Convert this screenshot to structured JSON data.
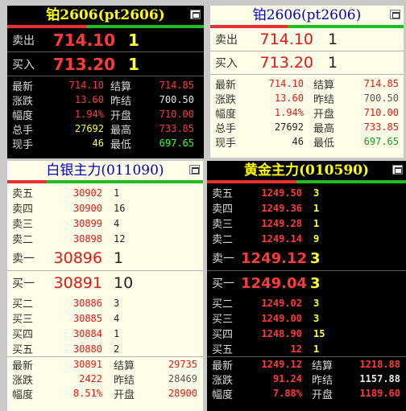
{
  "colors": {
    "up": "#ff3a3a",
    "down": "#33ff33",
    "volume": "#ffff33",
    "title_dark": "#ffff00",
    "title_light": "#0000c0"
  },
  "icons": {
    "panel_button": "maximize-icon"
  },
  "panels": {
    "pt_dark": {
      "title": "铂2606(pt2606)",
      "sell": {
        "label": "卖出",
        "price": "714.10",
        "vol": "1"
      },
      "buy": {
        "label": "买入",
        "price": "713.20",
        "vol": "1"
      },
      "stats": [
        {
          "l1": "最新",
          "v1": "714.10",
          "l2": "结算",
          "v2": "714.85"
        },
        {
          "l1": "涨跌",
          "v1": "13.60",
          "l2": "昨结",
          "v2": "700.50"
        },
        {
          "l1": "幅度",
          "v1": "1.94%",
          "l2": "开盘",
          "v2": "710.00"
        },
        {
          "l1": "总手",
          "v1": "27692",
          "l2": "最高",
          "v2": "733.85"
        },
        {
          "l1": "现手",
          "v1": "46",
          "l2": "最低",
          "v2": "697.65"
        }
      ]
    },
    "pt_light": {
      "title": "铂2606(pt2606)",
      "sell": {
        "label": "卖出",
        "price": "714.10",
        "vol": "1"
      },
      "buy": {
        "label": "买入",
        "price": "713.20",
        "vol": "1"
      },
      "stats": [
        {
          "l1": "最新",
          "v1": "714.10",
          "l2": "结算",
          "v2": "714.85"
        },
        {
          "l1": "涨跌",
          "v1": "13.60",
          "l2": "昨结",
          "v2": "700.50"
        },
        {
          "l1": "幅度",
          "v1": "1.94%",
          "l2": "开盘",
          "v2": "710.00"
        },
        {
          "l1": "总手",
          "v1": "27692",
          "l2": "最高",
          "v2": "733.85"
        },
        {
          "l1": "现手",
          "v1": "46",
          "l2": "最低",
          "v2": "697.65"
        }
      ]
    },
    "silver": {
      "title": "白银主力(011090)",
      "asks": [
        {
          "label": "卖五",
          "price": "30902",
          "vol": "1"
        },
        {
          "label": "卖四",
          "price": "30900",
          "vol": "16"
        },
        {
          "label": "卖三",
          "price": "30899",
          "vol": "4"
        },
        {
          "label": "卖二",
          "price": "30898",
          "vol": "12"
        }
      ],
      "ask1": {
        "label": "卖一",
        "price": "30896",
        "vol": "1"
      },
      "bid1": {
        "label": "买一",
        "price": "30891",
        "vol": "10"
      },
      "bids": [
        {
          "label": "买二",
          "price": "30886",
          "vol": "3"
        },
        {
          "label": "买三",
          "price": "30885",
          "vol": "4"
        },
        {
          "label": "买四",
          "price": "30884",
          "vol": "1"
        },
        {
          "label": "买五",
          "price": "30880",
          "vol": "2"
        }
      ],
      "stats": [
        {
          "l1": "最新",
          "v1": "30891",
          "l2": "结算",
          "v2": "29735"
        },
        {
          "l1": "涨跌",
          "v1": "2422",
          "l2": "昨结",
          "v2": "28469"
        },
        {
          "l1": "幅度",
          "v1": "8.51%",
          "l2": "开盘",
          "v2": "28900"
        }
      ]
    },
    "gold": {
      "title": "黄金主力(010590)",
      "asks": [
        {
          "label": "卖五",
          "price": "1249.50",
          "vol": "3"
        },
        {
          "label": "卖四",
          "price": "1249.36",
          "vol": "1"
        },
        {
          "label": "卖三",
          "price": "1249.28",
          "vol": "1"
        },
        {
          "label": "卖二",
          "price": "1249.14",
          "vol": "9"
        }
      ],
      "ask1": {
        "label": "卖一",
        "price": "1249.12",
        "vol": "3"
      },
      "bid1": {
        "label": "买一",
        "price": "1249.04",
        "vol": "3"
      },
      "bids": [
        {
          "label": "买二",
          "price": "1249.02",
          "vol": "3"
        },
        {
          "label": "买三",
          "price": "1249.00",
          "vol": "3"
        },
        {
          "label": "买四",
          "price": "1248.90",
          "vol": "15"
        },
        {
          "label": "买五",
          "price": "12",
          "vol": "1"
        }
      ],
      "stats": [
        {
          "l1": "最新",
          "v1": "1249.12",
          "l2": "结算",
          "v2": "1218.88"
        },
        {
          "l1": "涨跌",
          "v1": "91.24",
          "l2": "昨结",
          "v2": "1157.88"
        },
        {
          "l1": "幅度",
          "v1": "7.88%",
          "l2": "开盘",
          "v2": "1189.60"
        }
      ]
    }
  }
}
